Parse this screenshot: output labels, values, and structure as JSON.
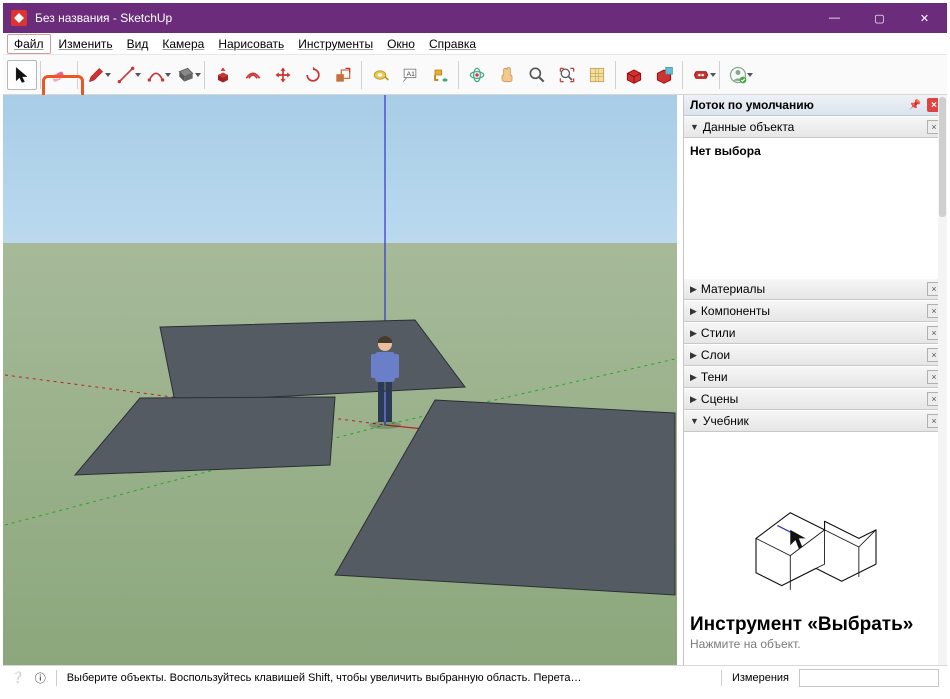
{
  "window": {
    "title": "Без названия - SketchUp"
  },
  "menu": {
    "items": [
      "Файл",
      "Изменить",
      "Вид",
      "Камера",
      "Нарисовать",
      "Инструменты",
      "Окно",
      "Справка"
    ]
  },
  "toolbar": {
    "select": "select-arrow",
    "tools": [
      "eraser",
      "pencil",
      "line",
      "arc",
      "rectangle",
      "pushpull",
      "offset",
      "move",
      "rotate",
      "scale",
      "tape",
      "text",
      "paint",
      "orbit",
      "pan",
      "zoom",
      "zoom-extents",
      "3dwarehouse-get",
      "3dwarehouse-send",
      "extensions",
      "user"
    ]
  },
  "tray": {
    "title": "Лоток по умолчанию",
    "entity_info": {
      "label": "Данные объекта",
      "none_selected": "Нет выбора"
    },
    "sections": [
      "Материалы",
      "Компоненты",
      "Стили",
      "Слои",
      "Тени",
      "Сцены"
    ],
    "tutorial": {
      "label": "Учебник",
      "tool_title": "Инструмент «Выбрать»",
      "hint": "Нажмите на объект."
    }
  },
  "statusbar": {
    "hint": "Выберите объекты. Воспользуйтесь клавишей Shift, чтобы увеличить выбранную область. Перета…",
    "measure_label": "Измерения",
    "measure_value": ""
  }
}
